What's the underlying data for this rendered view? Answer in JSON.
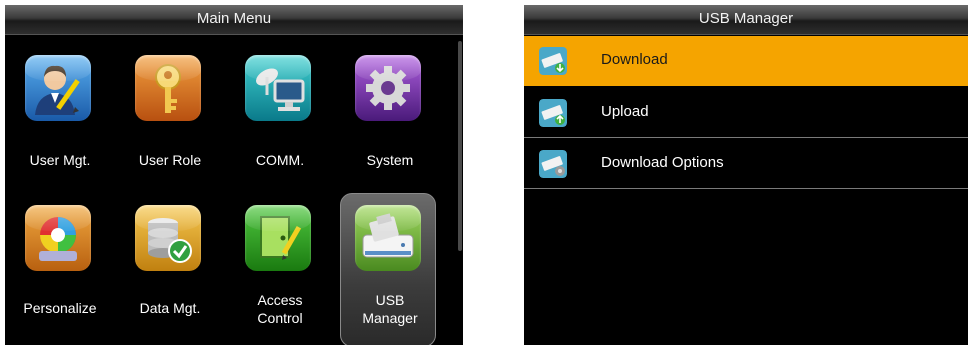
{
  "main_menu": {
    "title": "Main Menu",
    "items": [
      {
        "label": "User Mgt.",
        "icon": "user-mgt-icon",
        "color": "#2a7fd0"
      },
      {
        "label": "User Role",
        "icon": "key-icon",
        "color": "#e07a18"
      },
      {
        "label": "COMM.",
        "icon": "communication-icon",
        "color": "#12a0a8"
      },
      {
        "label": "System",
        "icon": "gear-icon",
        "color": "#7a3aa8"
      },
      {
        "label": "Personalize",
        "icon": "personalize-icon",
        "color": "#d88a20"
      },
      {
        "label": "Data Mgt.",
        "icon": "database-icon",
        "color": "#e0a020"
      },
      {
        "label": "Access\nControl",
        "icon": "access-control-icon",
        "color": "#3aa830"
      },
      {
        "label": "USB\nManager",
        "icon": "usb-drive-icon",
        "color": "#78b830",
        "selected": true
      }
    ]
  },
  "usb_manager": {
    "title": "USB Manager",
    "items": [
      {
        "label": "Download",
        "icon": "usb-download-icon",
        "selected": true
      },
      {
        "label": "Upload",
        "icon": "usb-upload-icon"
      },
      {
        "label": "Download Options",
        "icon": "usb-options-icon"
      }
    ],
    "highlight_color": "#f5a400"
  }
}
